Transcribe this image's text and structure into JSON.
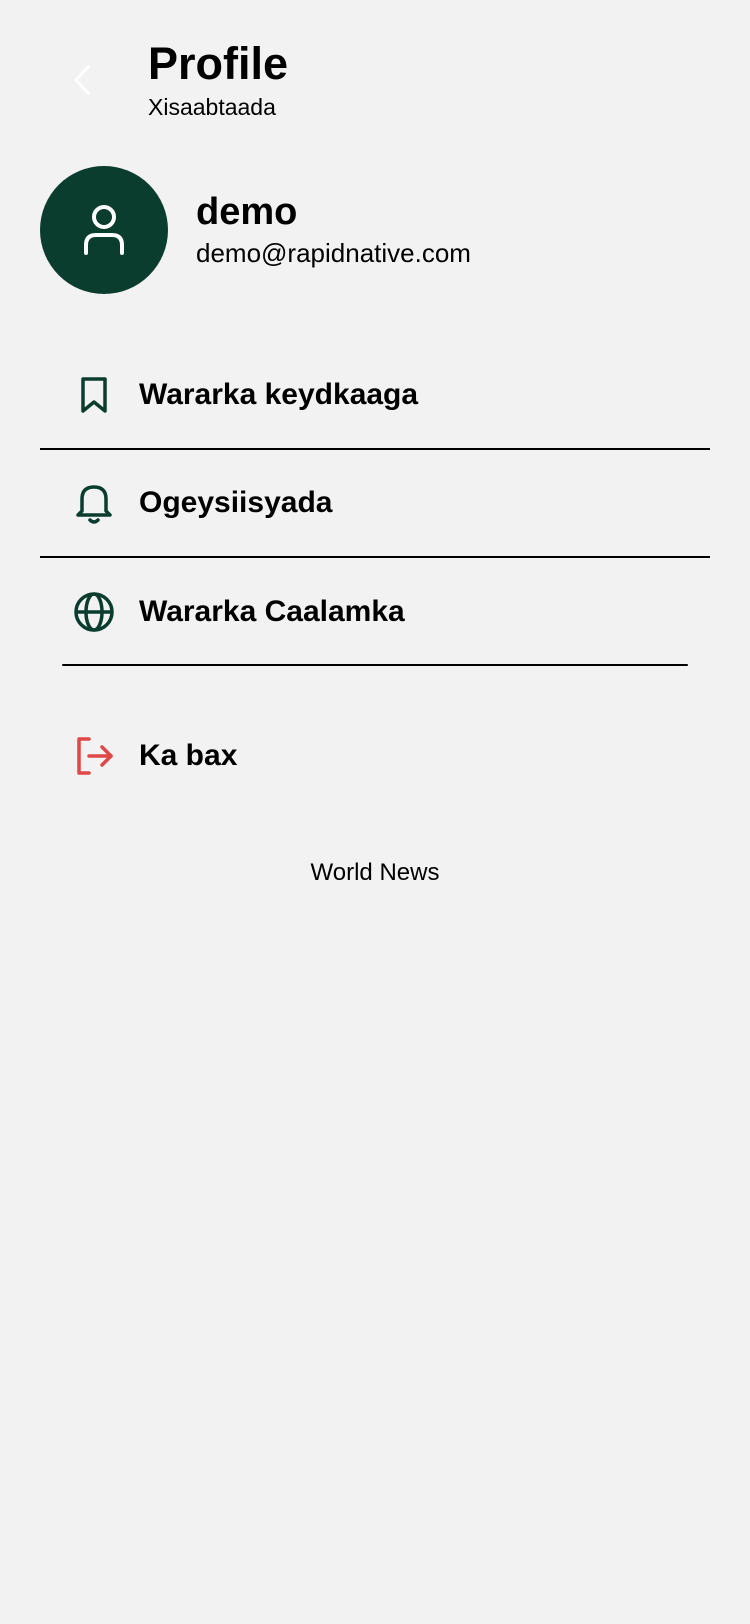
{
  "header": {
    "title": "Profile",
    "subtitle": "Xisaabtaada",
    "back_icon": "chevron-left-icon"
  },
  "profile": {
    "name": "demo",
    "email": "demo@rapidnative.com",
    "avatar_icon": "user-icon"
  },
  "menu": {
    "items": [
      {
        "label": "Wararka keydkaaga",
        "icon": "bookmark-icon"
      },
      {
        "label": "Ogeysiisyada",
        "icon": "bell-icon"
      },
      {
        "label": "Wararka Caalamka",
        "icon": "globe-icon"
      }
    ]
  },
  "logout": {
    "label": "Ka bax",
    "icon": "logout-icon"
  },
  "footer": {
    "label": "World News"
  },
  "colors": {
    "background": "#f2f2f2",
    "primary": "#0b3d2e",
    "danger": "#e04848",
    "text": "#000000"
  }
}
